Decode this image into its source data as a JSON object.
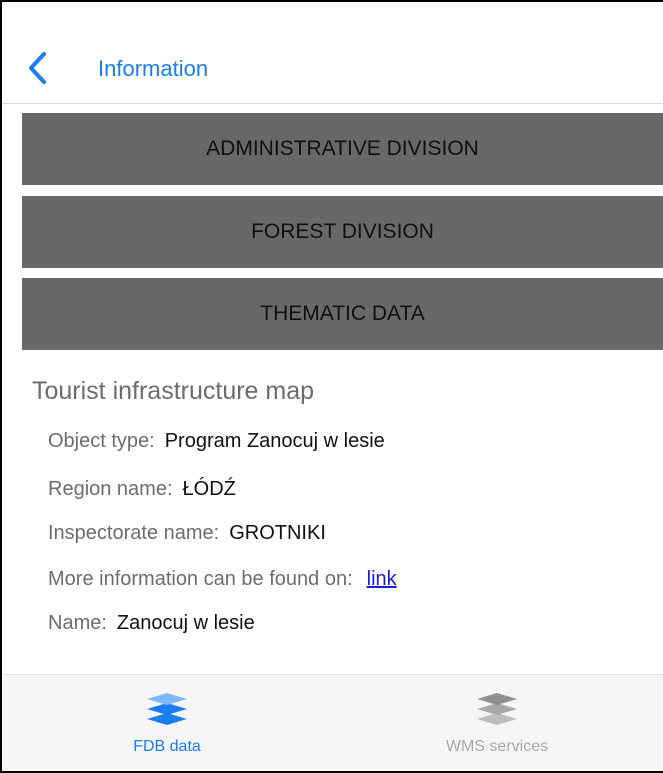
{
  "header": {
    "title": "Information"
  },
  "sections": {
    "admin_label": "ADMINISTRATIVE DIVISION",
    "forest_label": "FOREST DIVISION",
    "thematic_label": "THEMATIC DATA"
  },
  "info": {
    "heading": "Tourist infrastructure map",
    "object_type_label": "Object type:",
    "object_type_value": "Program Zanocuj w lesie",
    "region_label": "Region name:",
    "region_value": "ŁÓDŹ",
    "inspectorate_label": "Inspectorate name:",
    "inspectorate_value": "GROTNIKI",
    "more_info_label": "More information can be found on:",
    "more_info_link": "link",
    "name_label": "Name:",
    "name_value": "Zanocuj w lesie"
  },
  "tabbar": {
    "tabs": [
      {
        "label": "FDB data",
        "icon": "layers-icon",
        "active": true
      },
      {
        "label": "WMS services",
        "icon": "layers-icon",
        "active": false
      }
    ]
  },
  "colors": {
    "accent": "#1a7ef0",
    "section_bg": "#686868",
    "muted_text": "#6d6d6d",
    "link": "#1a1ae0",
    "tab_inactive": "#a8a8a8"
  }
}
